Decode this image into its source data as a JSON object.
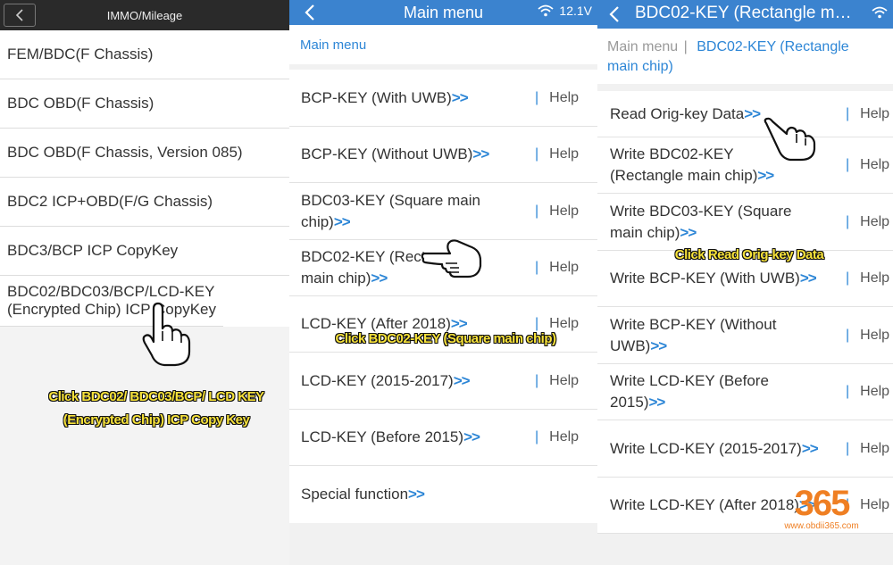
{
  "panel1": {
    "title": "IMMO/Mileage",
    "items": [
      "FEM/BDC(F Chassis)",
      "BDC OBD(F Chassis)",
      "BDC OBD(F Chassis, Version 085)",
      "BDC2 ICP+OBD(F/G Chassis)",
      "BDC3/BCP ICP CopyKey",
      "BDC02/BDC03/BCP/LCD-KEY (Encrypted Chip) ICP CopyKey"
    ],
    "caption_line1": "Click BDC02/ BDC03/BCP/ LCD KEY",
    "caption_line2": "(Encrypted Chip) ICP Copy Key"
  },
  "status": {
    "voltage": "12.1V"
  },
  "panel2": {
    "title": "Main menu",
    "breadcrumb": "Main menu",
    "arrows": ">>",
    "separator": "|",
    "help": "Help",
    "items": [
      {
        "label": "BCP-KEY (With UWB)",
        "help": true
      },
      {
        "label": "BCP-KEY (Without UWB)",
        "help": true
      },
      {
        "label": "BDC03-KEY (Square main chip)",
        "help": true
      },
      {
        "label": "BDC02-KEY (Rectangle main chip)",
        "help": true
      },
      {
        "label": "LCD-KEY (After 2018)",
        "help": true
      },
      {
        "label": "LCD-KEY (2015-2017)",
        "help": true
      },
      {
        "label": "LCD-KEY (Before 2015)",
        "help": true
      },
      {
        "label": "Special function",
        "help": false
      }
    ],
    "caption": "Click BDC02-KEY (Square main chip)"
  },
  "panel3": {
    "title": "BDC02-KEY (Rectangle m…",
    "breadcrumb_root": "Main menu",
    "breadcrumb_sep": "|",
    "breadcrumb_current": "BDC02-KEY (Rectangle main chip)",
    "arrows": ">>",
    "separator": "|",
    "help": "Help",
    "items": [
      "Read Orig-key Data",
      "Write BDC02-KEY (Rectangle main chip)",
      "Write BDC03-KEY (Square main chip)",
      "Write BCP-KEY (With UWB)",
      "Write BCP-KEY (Without UWB)",
      "Write LCD-KEY (Before 2015)",
      "Write LCD-KEY (2015-2017)",
      "Write LCD-KEY (After 2018)"
    ],
    "caption": "Click Read Orig-key Data"
  },
  "watermark": {
    "logo": "365",
    "url": "www.obdii365.com"
  },
  "icons": [
    "back-arrow-icon",
    "wifi-icon",
    "pointing-hand-icon"
  ]
}
